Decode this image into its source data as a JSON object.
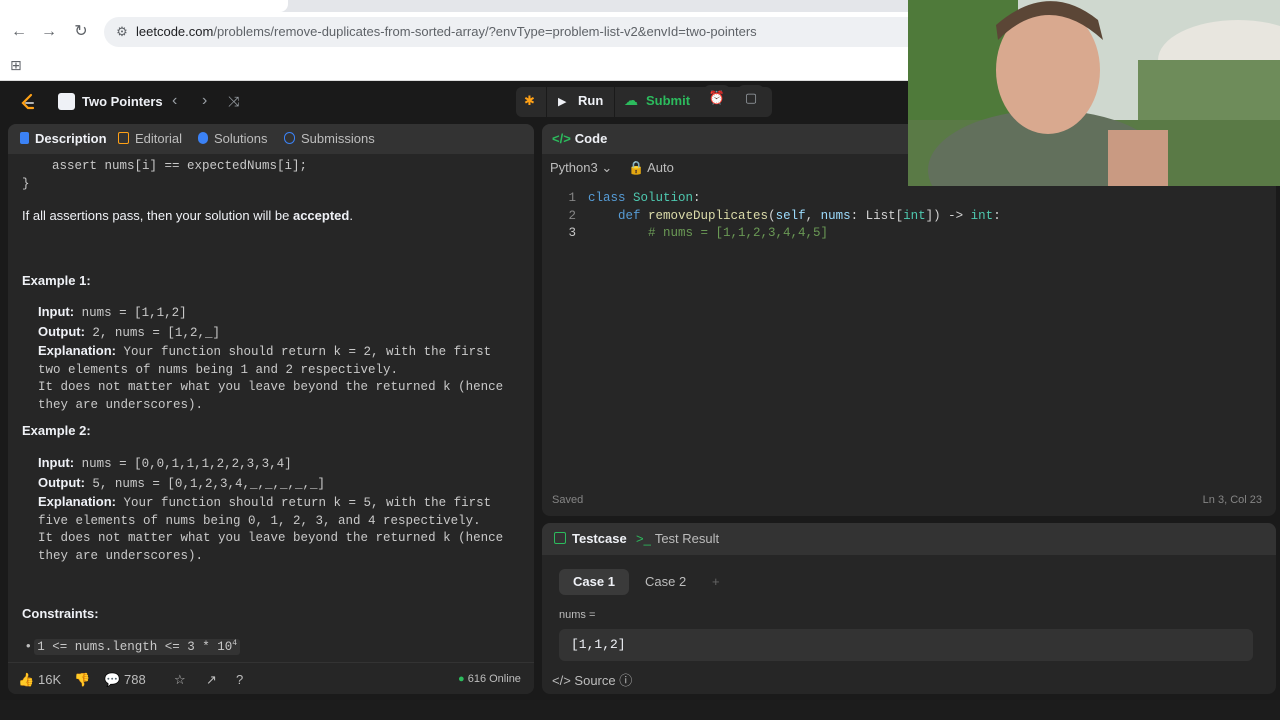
{
  "browser": {
    "url_base": "leetcode.com",
    "url_path": "/problems/remove-duplicates-from-sorted-array/?envType=problem-list-v2&envId=two-pointers"
  },
  "topbar": {
    "study_plan": "Two Pointers",
    "run": "Run",
    "submit": "Submit"
  },
  "left_tabs": [
    "Description",
    "Editorial",
    "Solutions",
    "Submissions"
  ],
  "description": {
    "code_tail_1": "    assert nums[i] == expectedNums[i];",
    "code_tail_2": "}",
    "accept_pre": "If all assertions pass, then your solution will be ",
    "accept_bold": "accepted",
    "accept_post": ".",
    "example1_title": "Example 1:",
    "example1": {
      "input_label": "Input:",
      "input": " nums = [1,1,2]",
      "output_label": "Output:",
      "output": " 2, nums = [1,2,_]",
      "expl_label": "Explanation:",
      "expl1": " Your function should return k = 2, with the first",
      "expl2": "two elements of nums being 1 and 2 respectively.",
      "expl3": "It does not matter what you leave beyond the returned k (hence",
      "expl4": "they are underscores)."
    },
    "example2_title": "Example 2:",
    "example2": {
      "input_label": "Input:",
      "input": " nums = [0,0,1,1,1,2,2,3,3,4]",
      "output_label": "Output:",
      "output": " 5, nums = [0,1,2,3,4,_,_,_,_,_]",
      "expl_label": "Explanation:",
      "expl1": " Your function should return k = 5, with the first",
      "expl2": "five elements of nums being 0, 1, 2, 3, and 4 respectively.",
      "expl3": "It does not matter what you leave beyond the returned k (hence",
      "expl4": "they are underscores)."
    },
    "constraints_title": "Constraints:",
    "constraint1": "1 <= nums.length <= 3 * 10",
    "constraint1_sup": "4"
  },
  "footer": {
    "likes": "16K",
    "comments": "788",
    "online": "616 Online"
  },
  "code": {
    "tab": "Code",
    "language": "Python3",
    "mode": "Auto",
    "lines": [
      "1",
      "2",
      "3"
    ],
    "line1_kw": "class ",
    "line1_cls": "Solution",
    "line1_end": ":",
    "line2_indent": "    ",
    "line2_kw": "def ",
    "line2_fn": "removeDuplicates",
    "line2_a": "(",
    "line2_self": "self",
    "line2_b": ", ",
    "line2_nums": "nums",
    "line2_c": ": List[",
    "line2_int": "int",
    "line2_d": "]) -> ",
    "line2_ret": "int",
    "line2_e": ":",
    "line3": "        # nums = [1,1,2,3,4,4,5]",
    "saved": "Saved",
    "cursor": "Ln 3, Col 23"
  },
  "testcase": {
    "tab1": "Testcase",
    "tab2": "Test Result",
    "case1": "Case 1",
    "case2": "Case 2",
    "add": "+",
    "var": "nums =",
    "value": "[1,1,2]",
    "source": "Source"
  },
  "colors": {
    "accent_green": "#2cbb5d",
    "leetcode_orange": "#ffa116"
  }
}
